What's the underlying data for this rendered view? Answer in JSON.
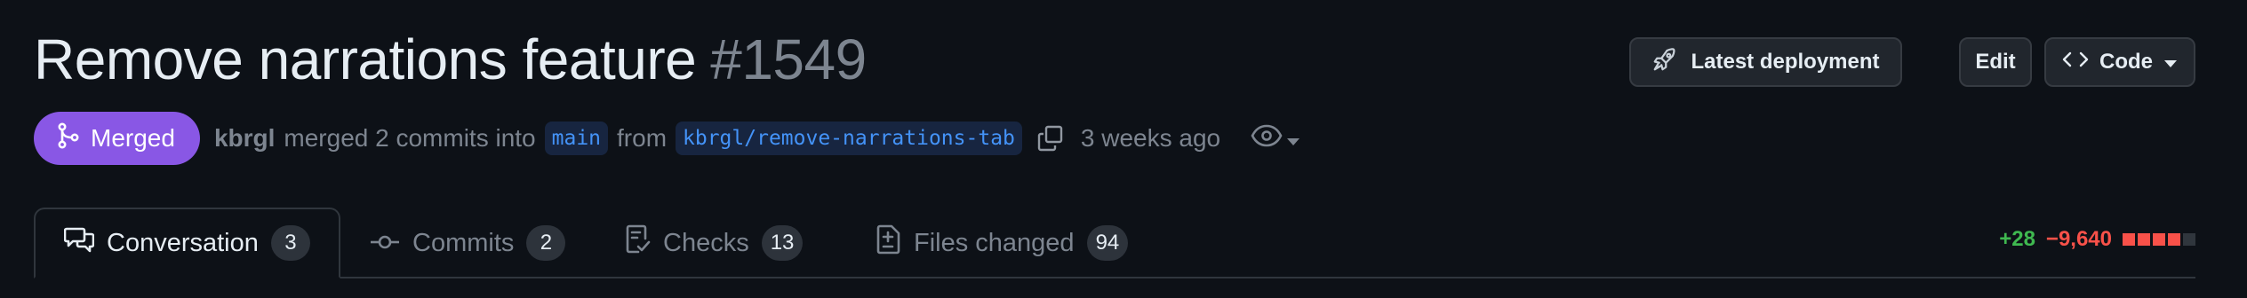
{
  "pr": {
    "title": "Remove narrations feature",
    "number": "#1549",
    "state": "Merged",
    "author": "kbrgl",
    "action_text": "merged 2 commits into",
    "base_branch": "main",
    "from_text": "from",
    "head_branch": "kbrgl/remove-narrations-tab",
    "time": "3 weeks ago"
  },
  "header_actions": {
    "deployment_label": "Latest deployment",
    "edit_label": "Edit",
    "code_label": "Code"
  },
  "tabs": [
    {
      "label": "Conversation",
      "count": "3",
      "icon": "comment-discussion-icon",
      "active": true
    },
    {
      "label": "Commits",
      "count": "2",
      "icon": "git-commit-icon",
      "active": false
    },
    {
      "label": "Checks",
      "count": "13",
      "icon": "checklist-icon",
      "active": false
    },
    {
      "label": "Files changed",
      "count": "94",
      "icon": "file-diff-icon",
      "active": false
    }
  ],
  "diffstat": {
    "additions": "+28",
    "deletions": "−9,640",
    "blocks": [
      "deleted",
      "deleted",
      "deleted",
      "deleted",
      "neutral"
    ]
  },
  "colors": {
    "background": "#0d1117",
    "merged": "#8957e5",
    "additions": "#3fb950",
    "deletions": "#f85149",
    "branch_link": "#4493f8"
  }
}
